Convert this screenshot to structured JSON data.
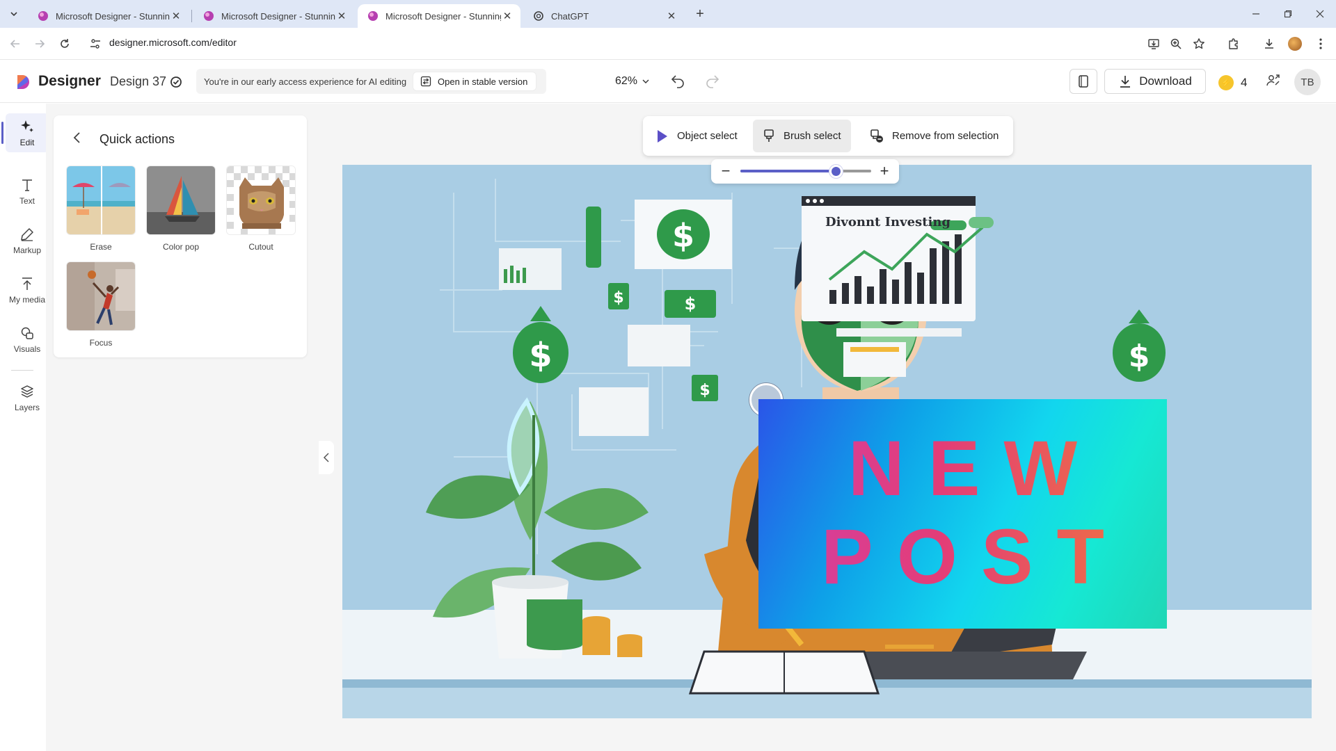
{
  "browser": {
    "tabs": [
      {
        "title": "Microsoft Designer - Stunning designs in a flash",
        "active": false
      },
      {
        "title": "Microsoft Designer - Stunning designs in a flash",
        "active": false
      },
      {
        "title": "Microsoft Designer - Stunning designs in a flash",
        "active": true
      },
      {
        "title": "ChatGPT",
        "active": false
      }
    ],
    "url": "designer.microsoft.com/editor"
  },
  "app": {
    "name": "Designer",
    "design_name": "Design 37",
    "banner_text": "You're in our early access experience for AI editing",
    "stable_button": "Open in stable version",
    "zoom": "62%",
    "download_label": "Download",
    "credits": "4",
    "avatar_initials": "TB"
  },
  "rail": {
    "items": [
      {
        "label": "Edit",
        "icon": "sparkle-icon",
        "active": true
      },
      {
        "label": "Text",
        "icon": "text-icon",
        "active": false
      },
      {
        "label": "Markup",
        "icon": "pen-icon",
        "active": false
      },
      {
        "label": "My media",
        "icon": "upload-icon",
        "active": false
      },
      {
        "label": "Visuals",
        "icon": "shapes-icon",
        "active": false
      },
      {
        "label": "Layers",
        "icon": "layers-icon",
        "active": false
      }
    ]
  },
  "panel": {
    "title": "Quick actions",
    "actions": [
      {
        "label": "Erase"
      },
      {
        "label": "Color pop"
      },
      {
        "label": "Cutout"
      },
      {
        "label": "Focus"
      }
    ]
  },
  "selection_toolbar": {
    "object_select": "Object select",
    "brush_select": "Brush select",
    "remove_selection": "Remove from selection"
  },
  "brush_size": {
    "value": 0.73
  },
  "canvas": {
    "chart_title": "Divonnt Investing",
    "overlay_line1": "NEW",
    "overlay_line2": "POST"
  },
  "colors": {
    "accent": "#5b5fc7",
    "canvas_bg": "#a9cde4",
    "money_green": "#2f9a4a"
  }
}
